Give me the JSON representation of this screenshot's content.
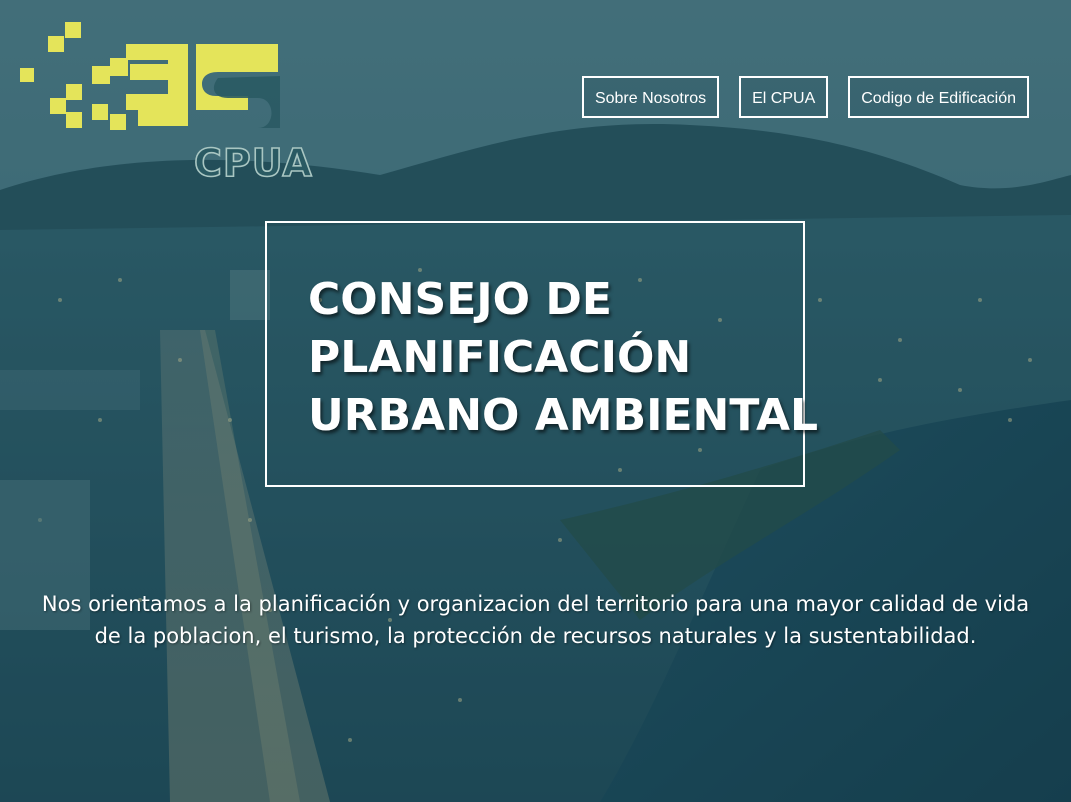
{
  "logo": {
    "text": "CPUA",
    "colors": {
      "yellow": "#e4e45a",
      "teal": "#2a5a63",
      "outline": "#a9c6c2"
    }
  },
  "nav": {
    "items": [
      {
        "label": "Sobre Nosotros"
      },
      {
        "label": "El CPUA"
      },
      {
        "label": "Codigo de Edificación"
      }
    ]
  },
  "hero": {
    "title_lines": [
      "CONSEJO DE",
      "PLANIFICACIÓN",
      "URBANO AMBIENTAL"
    ],
    "subtitle": "Nos orientamos a la planificación y organizacion del territorio para una mayor calidad de vida de la poblacion, el turismo, la protección de recursos naturales y la sustentabilidad."
  },
  "colors": {
    "overlay": "#1f4f5e",
    "text": "#ffffff"
  }
}
